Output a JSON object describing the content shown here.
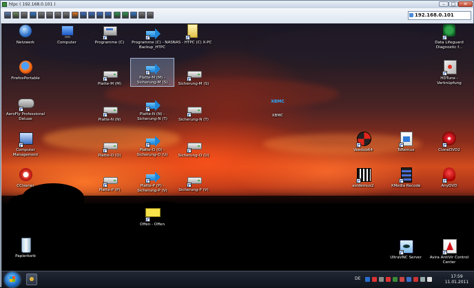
{
  "window": {
    "title": "htpc ( 192.168.0.101 )",
    "minimize": "–",
    "maximize": "□",
    "close": "✕"
  },
  "toolbar": {
    "host": "192.168.0.101",
    "buttons": [
      {
        "name": "options-icon",
        "color": "#5a7fb3"
      },
      {
        "name": "connection-info-icon",
        "color": "#6a8c5a"
      },
      {
        "name": "settings-icon",
        "color": "#7c7c7c"
      },
      {
        "name": "refresh-icon",
        "color": "#2f7bd0"
      },
      {
        "name": "ctrl-alt-del-icon",
        "color": "#7c7c7c"
      },
      {
        "name": "ctrl-key-icon",
        "color": "#7c7c7c"
      },
      {
        "name": "alt-key-icon",
        "color": "#7c7c7c"
      },
      {
        "name": "windows-key-icon",
        "color": "#7c7c7c"
      },
      {
        "name": "stop-icon",
        "color": "#e47a1e"
      },
      {
        "name": "fullscreen-icon",
        "color": "#3a6ec5"
      },
      {
        "name": "file-transfer-icon",
        "color": "#3a6ec5"
      },
      {
        "name": "scale-icon",
        "color": "#3a6ec5"
      },
      {
        "name": "monitor-icon",
        "color": "#3a6ec5"
      },
      {
        "name": "chat-icon",
        "color": "#2e9b4f"
      },
      {
        "name": "send-icon",
        "color": "#2e9b4f"
      },
      {
        "name": "record-icon",
        "color": "#2f7bd0"
      },
      {
        "name": "screenshot-icon",
        "color": "#7c7c7c"
      },
      {
        "name": "fullscreen-toggle-icon",
        "color": "#7c7c7c"
      }
    ]
  },
  "desktop": {
    "icons": {
      "netzwerk": "Netzwerk",
      "computer": "Computer",
      "programme_c": "Programme (C)",
      "programme_nas": "Programme (C) - NAS\nBackup_HTPC",
      "nas_htpc": "NAS - HTPC (C) X-PC",
      "firefox": "FirefoxPortable",
      "platte_m": "Platte-M (M)",
      "platte_m_sicherung": "Platte-M (M) -\nSicherung-M (S)",
      "sicherung_m": "Sicherung-M (S)",
      "aerofly": "AeroFly Professional\nDeluxe",
      "platte_n": "Platte-N (N)",
      "platte_n_sicherung": "Platte-N (N) -\nSicherung-N (T)",
      "sicherung_n": "Sicherung-N (T)",
      "xbmc": "XBMC",
      "computer_mgmt": "Computer\nManagement",
      "platte_o": "Platte-O (O)",
      "platte_o_sicherung": "Platte-O (O) -\nSicherung-O (U)",
      "sicherung_o": "Sicherung-O (U)",
      "ccleaner": "CCleaner",
      "platte_p": "Platte-P (P)",
      "platte_p_sicherung": "Platte-P (P) -\nSicherung-P (V)",
      "sicherung_p": "Sicherung-P (V)",
      "offen": "Offen - Offen",
      "papierkorb": "Papierkorb",
      "lifeguard": "Data Lifeguard\nDiagnostic f...",
      "hdtune": "HDTune -\nVerknüpfung",
      "veedub": "Veedub64",
      "tsremux": "TsRemux",
      "clonedvd": "CloneDVD2",
      "avidemux": "avidemux2",
      "xmedia": "XMedia Recode",
      "anydvd": "AnyDVD",
      "ultravnc": "UltraVNC Server",
      "avira": "Avira AntiVir Control\nCenter"
    }
  },
  "taskbar": {
    "language": "DE",
    "time": "17:59",
    "date": "11.01.2011",
    "tray_colors": [
      "#2a6fd0",
      "#d33",
      "#8a8a8a",
      "#d33",
      "#3a8a3a",
      "#c44",
      "#3a6ec5",
      "#c33",
      "#9aa",
      "#ddd"
    ]
  }
}
